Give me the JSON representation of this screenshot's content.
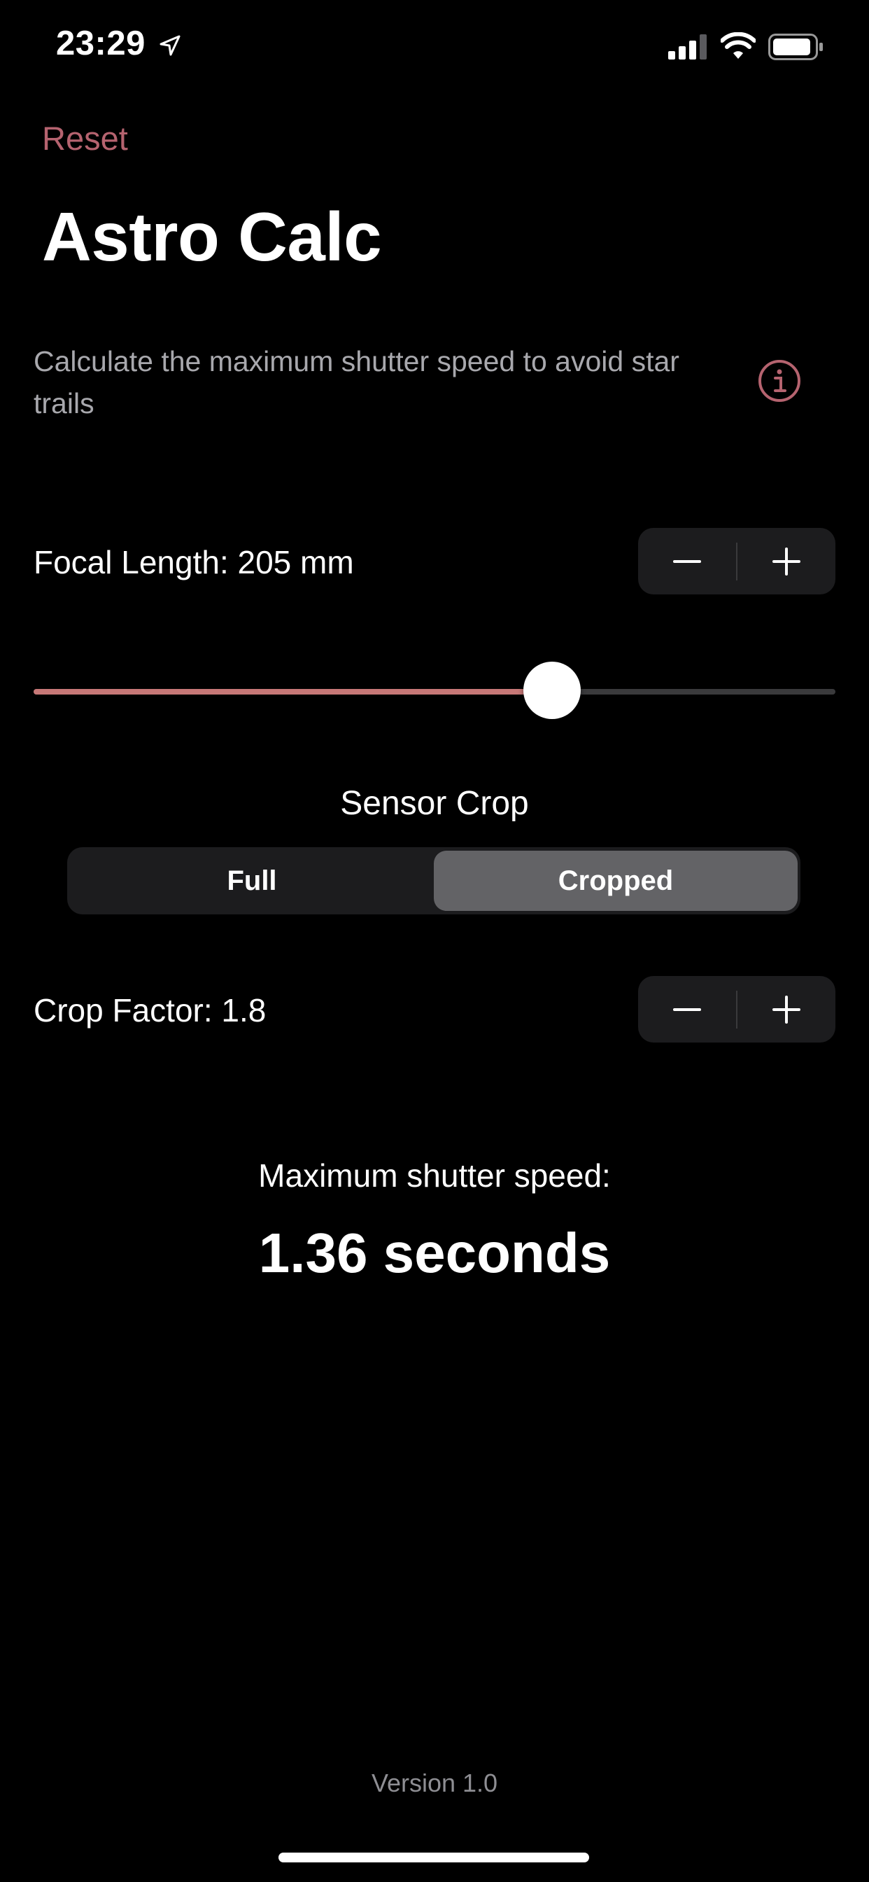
{
  "status_bar": {
    "time": "23:29",
    "icons": [
      "location-arrow-icon",
      "signal-icon",
      "wifi-icon",
      "battery-icon"
    ]
  },
  "nav": {
    "reset_label": "Reset"
  },
  "header": {
    "title": "Astro Calc",
    "description": "Calculate the maximum shutter speed to avoid star trails",
    "info_icon": "info-circle-icon"
  },
  "focal_length": {
    "label": "Focal Length: 205 mm",
    "minus_icon": "minus-icon",
    "plus_icon": "plus-icon",
    "slider_fraction": 0.647
  },
  "sensor_crop": {
    "label": "Sensor Crop",
    "options": [
      "Full",
      "Cropped"
    ],
    "selected": "Cropped"
  },
  "crop_factor": {
    "label": "Crop Factor: 1.8",
    "minus_icon": "minus-icon",
    "plus_icon": "plus-icon"
  },
  "result": {
    "label": "Maximum shutter speed:",
    "value": "1.36 seconds"
  },
  "footer": {
    "version": "Version 1.0"
  },
  "colors": {
    "accent": "#b5636f",
    "slider_fill": "#c77877",
    "background": "#000000",
    "control_bg": "#1c1c1e",
    "segment_selected": "#636366"
  }
}
